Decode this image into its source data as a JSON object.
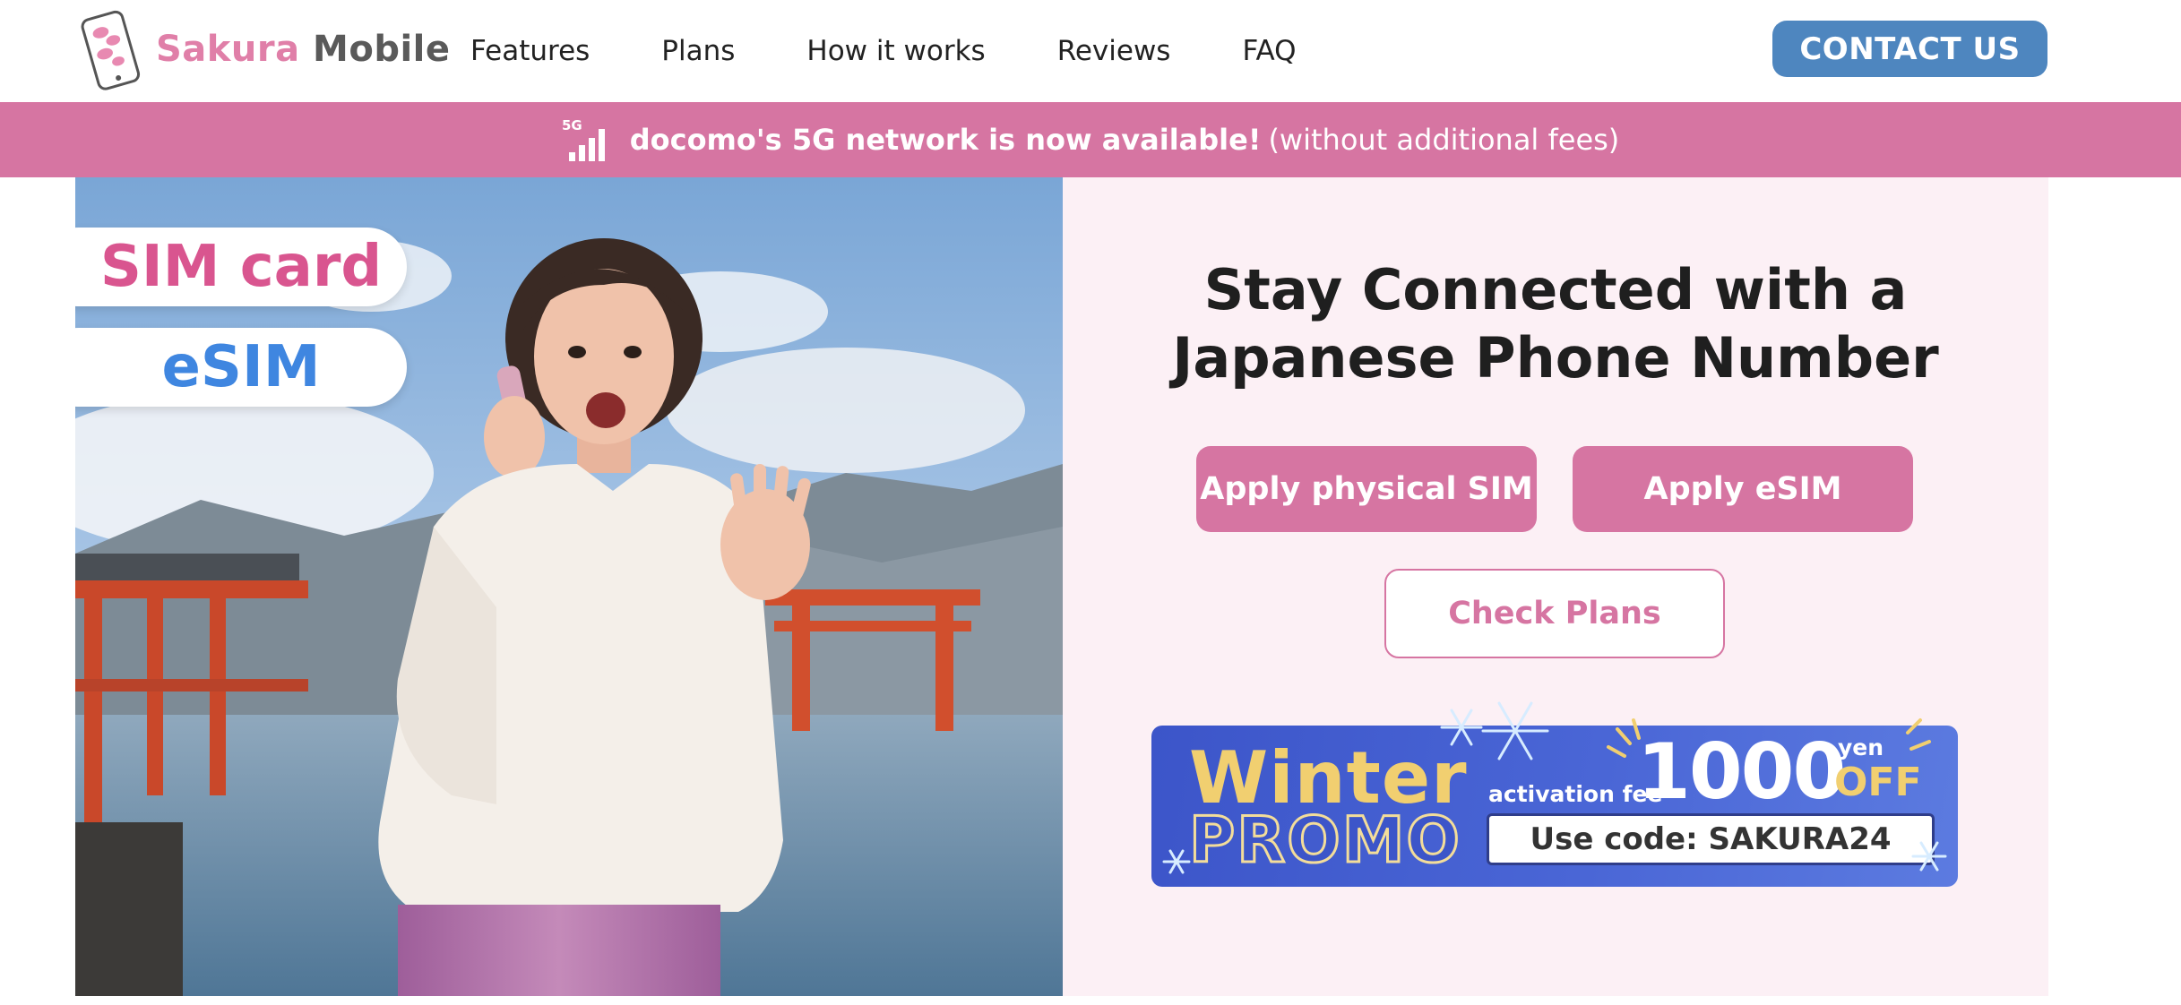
{
  "header": {
    "logo": {
      "brand_part1": "Sakura",
      "brand_part2": "Mobile"
    },
    "nav": [
      {
        "label": "Features"
      },
      {
        "label": "Plans"
      },
      {
        "label": "How it works"
      },
      {
        "label": "Reviews"
      },
      {
        "label": "FAQ"
      }
    ],
    "contact_label": "CONTACT US"
  },
  "banner": {
    "icon": "signal-5g-icon",
    "icon_text": "5G",
    "strong_text": "docomo's 5G network is now available!",
    "light_text": "(without additional fees)"
  },
  "hero": {
    "tags": {
      "sim": "SIM card",
      "esim": "eSIM"
    },
    "title_line1": "Stay Connected with a",
    "title_line2": "Japanese Phone Number",
    "buttons": {
      "apply_physical": "Apply physical SIM",
      "apply_esim": "Apply eSIM",
      "check_plans": "Check Plans"
    },
    "promo": {
      "winter": "Winter",
      "promo": "PROMO",
      "activation": "activation fee",
      "amount": "1000",
      "yen": "yen",
      "off": "OFF",
      "code": "Use code: SAKURA24"
    }
  },
  "colors": {
    "brand_pink": "#d675a2",
    "contact_blue": "#4e86bf",
    "panel_bg": "#fcf0f5",
    "promo_blue": "#3c55c9",
    "promo_gold": "#f1cf70"
  }
}
